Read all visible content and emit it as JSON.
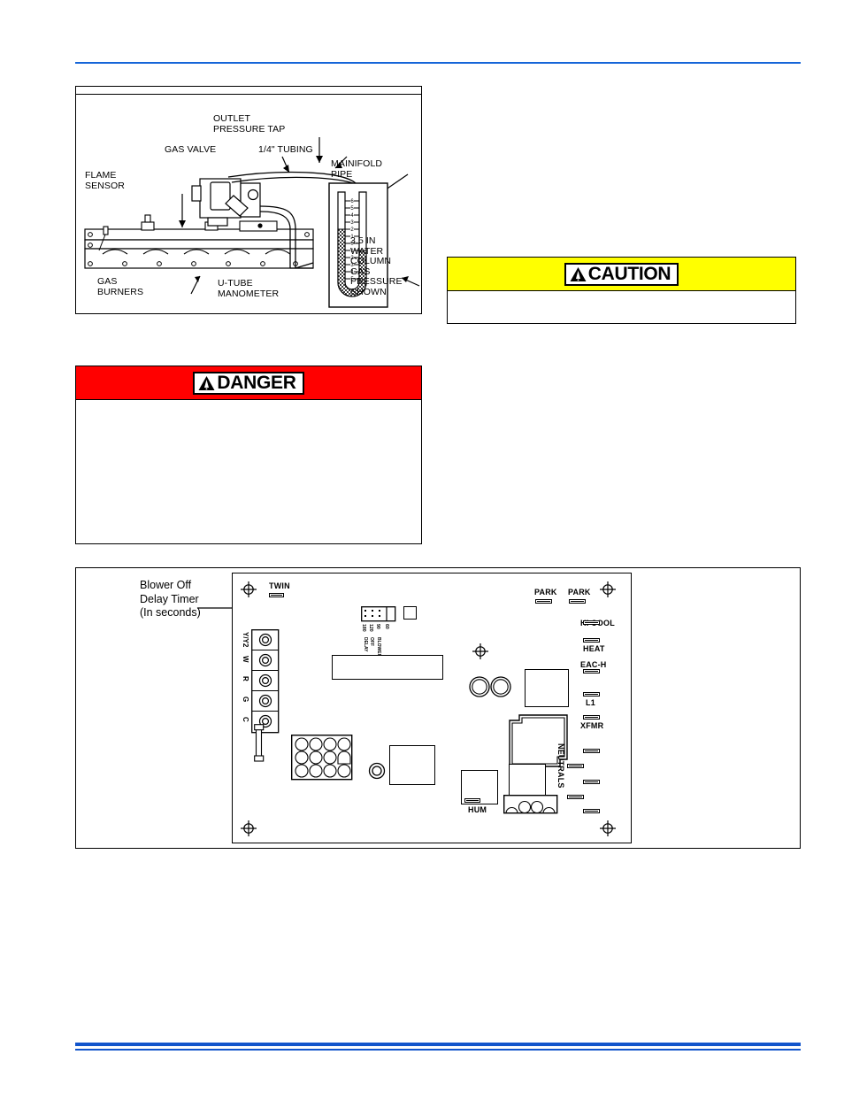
{
  "page": {
    "background": "#ffffff",
    "rule_color": "#1565d8"
  },
  "figure_manifold": {
    "name": "gas manifold and u-tube manometer diagram",
    "labels": {
      "outlet_pressure_tap": "OUTLET\nPRESSURE TAP",
      "gas_valve": "GAS VALVE",
      "tubing": "1/4\" TUBING",
      "mainifold_pipe": "MAINIFOLD\nPIPE",
      "flame_sensor": "FLAME\nSENSOR",
      "gas_burners": "GAS\nBURNERS",
      "u_tube_manometer": "U-TUBE\nMANOMETER",
      "pressure_shown": "3.5 IN\nWATER\nCOLUMN\nGAS\nPRESSURE\nSHOWN"
    },
    "manometer_scale": [
      "6",
      "5",
      "4",
      "3",
      "2",
      "1",
      "0",
      "1",
      "2",
      "3",
      "4",
      "5",
      "6"
    ]
  },
  "danger": {
    "word": "DANGER",
    "band_color": "#ff0000",
    "body": ""
  },
  "caution": {
    "word": "CAUTION",
    "band_color": "#ffff00",
    "body": ""
  },
  "figure_board": {
    "name": "furnace control board diagram",
    "callout": "Blower Off\nDelay Timer\n(In seconds)",
    "twin_label": "TWIN",
    "park_labels": [
      "PARK",
      "PARK"
    ],
    "terminal_strip": [
      "Y/Y2",
      "W",
      "R",
      "G",
      "C"
    ],
    "blower_delay_options": [
      "180",
      "120",
      "90",
      "60"
    ],
    "blower_delay_title": "BLOWER\nOFF\nDELAY",
    "right_labels": [
      "HI COOL",
      "HEAT",
      "EAC-H",
      "L1",
      "XFMR"
    ],
    "neutrals_label": "NEUTRALS",
    "hum_label": "HUM"
  }
}
